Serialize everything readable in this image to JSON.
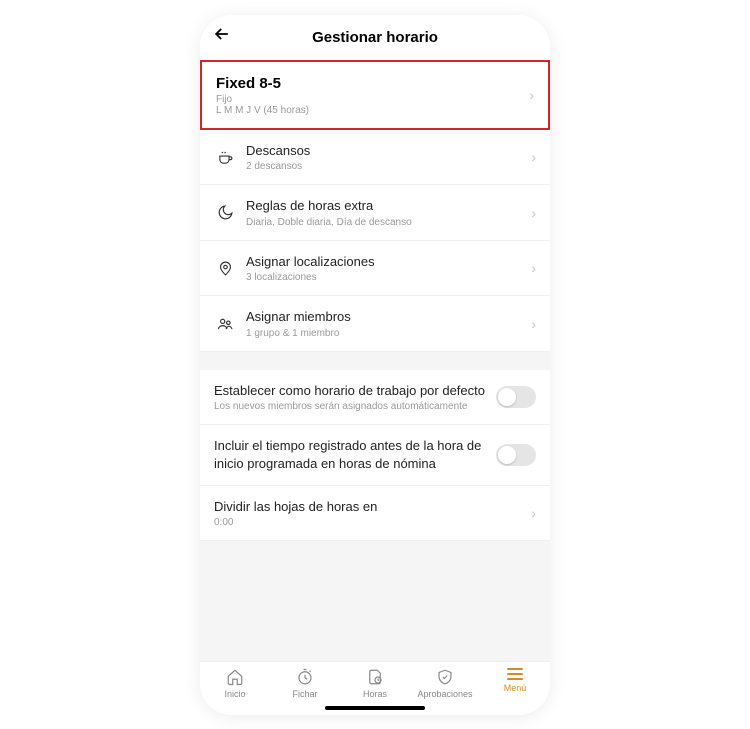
{
  "header": {
    "title": "Gestionar horario"
  },
  "schedule_card": {
    "title": "Fixed 8-5",
    "type": "Fijo",
    "summary": "L M M J V (45 horas)"
  },
  "rows": {
    "breaks": {
      "title": "Descansos",
      "sub": "2 descansos"
    },
    "overtime": {
      "title": "Reglas de horas extra",
      "sub": "Diaria, Doble diaria, Día de descanso"
    },
    "locations": {
      "title": "Asignar localizaciones",
      "sub": "3 localizaciones"
    },
    "members": {
      "title": "Asignar miembros",
      "sub": "1 grupo & 1 miembro"
    },
    "default_schedule": {
      "title": "Establecer como horario de trabajo por defecto",
      "sub": "Los nuevos miembros serán asignados automáticamente"
    },
    "include_before": {
      "title": "Incluir el tiempo registrado antes de la hora de inicio programada en horas de nómina"
    },
    "split_sheets": {
      "title": "Dividir las hojas de horas en",
      "sub": "0:00"
    }
  },
  "tabs": {
    "home": "Inicio",
    "clock": "Fichar",
    "hours": "Horas",
    "approvals": "Aprobaciones",
    "menu": "Menú"
  }
}
